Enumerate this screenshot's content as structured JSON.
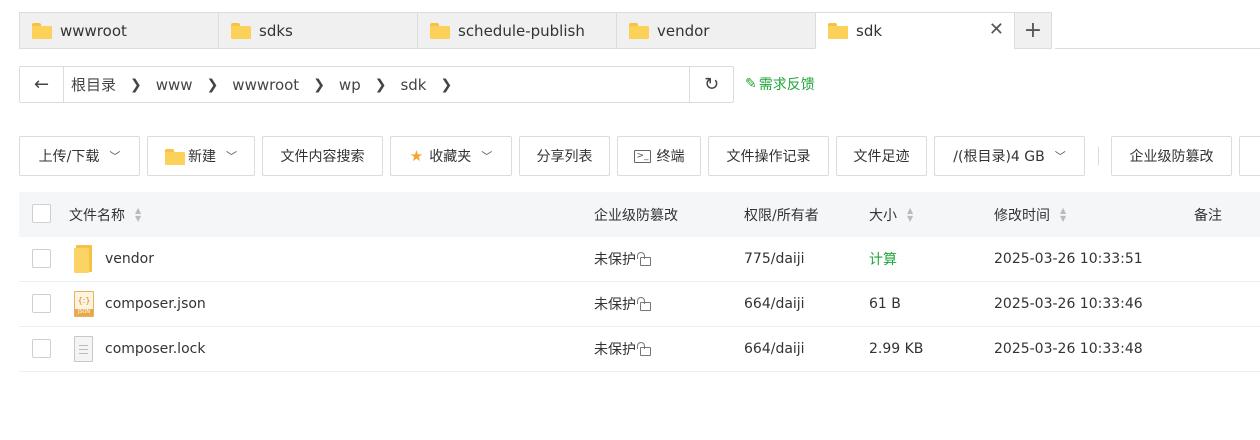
{
  "tabs": [
    {
      "label": "wwwroot",
      "active": false
    },
    {
      "label": "sdks",
      "active": false
    },
    {
      "label": "schedule-publish",
      "active": false
    },
    {
      "label": "vendor",
      "active": false
    },
    {
      "label": "sdk",
      "active": true
    }
  ],
  "tab_close": "✕",
  "tab_add": "+",
  "path": {
    "back": "←",
    "refresh": "↻",
    "crumbs": [
      "根目录",
      "www",
      "wwwroot",
      "wp",
      "sdk"
    ],
    "separator": "❯"
  },
  "feedback": {
    "icon": "✎",
    "label": "需求反馈"
  },
  "toolbar": {
    "upload": "上传/下载",
    "new": "新建",
    "search": "文件内容搜索",
    "favorites": "收藏夹",
    "share": "分享列表",
    "terminal": "终端",
    "log": "文件操作记录",
    "footprint": "文件足迹",
    "disk": "/(根目录)4 GB",
    "tamper": "企业级防篡改"
  },
  "table": {
    "headers": {
      "name": "文件名称",
      "tamper": "企业级防篡改",
      "perm": "权限/所有者",
      "size": "大小",
      "mtime": "修改时间",
      "note": "备注"
    },
    "rows": [
      {
        "type": "folder",
        "name": "vendor",
        "tamper": "未保护",
        "perm": "775/daiji",
        "size": "计算",
        "mtime": "2025-03-26 10:33:51"
      },
      {
        "type": "json",
        "name": "composer.json",
        "tamper": "未保护",
        "perm": "664/daiji",
        "size": "61 B",
        "mtime": "2025-03-26 10:33:46"
      },
      {
        "type": "file",
        "name": "composer.lock",
        "tamper": "未保护",
        "perm": "664/daiji",
        "size": "2.99 KB",
        "mtime": "2025-03-26 10:33:48"
      }
    ]
  },
  "colors": {
    "accent": "#20a53a",
    "folder": "#fbd15a",
    "header_bg": "#f5f6f8"
  }
}
